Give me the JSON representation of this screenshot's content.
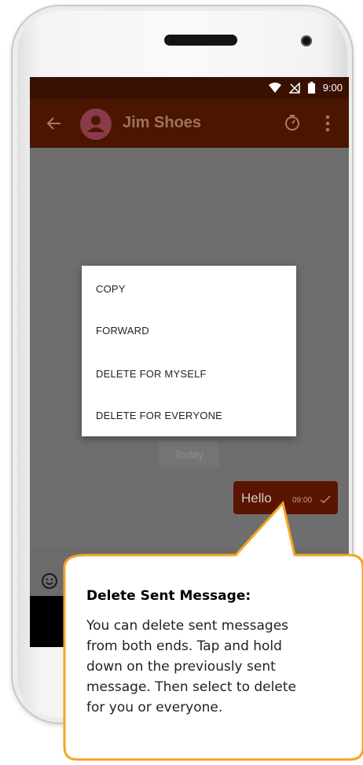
{
  "status_bar": {
    "time": "9:00"
  },
  "app_bar": {
    "contact_name": "Jim Shoes"
  },
  "context_menu": {
    "items": [
      "COPY",
      "FORWARD",
      "DELETE FOR MYSELF",
      "DELETE FOR EVERYONE"
    ]
  },
  "chat": {
    "date_label": "Today",
    "message": {
      "text": "Hello",
      "time": "09:00"
    }
  },
  "callout": {
    "title": "Delete Sent Message:",
    "lines": [
      "You can delete sent messages",
      "from both ends. Tap and hold",
      "down on the previously sent",
      "message. Then select to delete",
      "for you or everyone."
    ]
  },
  "colors": {
    "app_bar": "#4a1600",
    "status_bar": "#3a1000",
    "bubble": "#5a1500",
    "callout_border": "#f5a623",
    "callout_fill": "#fff8e6"
  },
  "icons": [
    "wifi-icon",
    "no-signal-icon",
    "battery-icon",
    "back-arrow-icon",
    "person-icon",
    "timer-icon",
    "more-vert-icon",
    "emoji-icon",
    "check-icon"
  ]
}
